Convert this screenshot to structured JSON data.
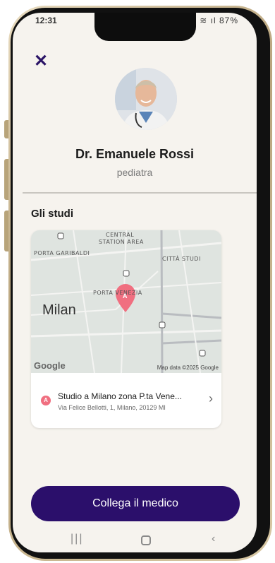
{
  "status_bar": {
    "time": "12:31",
    "right_icons": "◂ ≋ ıl 87%"
  },
  "header": {
    "close_symbol": "✕"
  },
  "doctor": {
    "name": "Dr. Emanuele Rossi",
    "specialty": "pediatra"
  },
  "section": {
    "title": "Gli studi"
  },
  "map": {
    "labels": [
      "PORTA GARIBALDI",
      "CENTRAL",
      "STATION AREA",
      "CITTÀ STUDI",
      "PORTA VENEZIA"
    ],
    "city": "Milan",
    "google_logo": "Google",
    "attribution": "Map data ©2025 Google",
    "marker_letter": "A"
  },
  "studio": {
    "badge": "A",
    "name": "Studio a Milano zona P.ta Vene...",
    "address": "Via Felice Bellotti, 1, Milano, 20129 MI",
    "chevron": "›"
  },
  "cta": {
    "label": "Collega il medico"
  },
  "nav": {
    "recents": "|||",
    "back": "‹"
  },
  "colors": {
    "primary": "#2b0f6b",
    "marker": "#f06f80",
    "background": "#f6f3ee"
  }
}
